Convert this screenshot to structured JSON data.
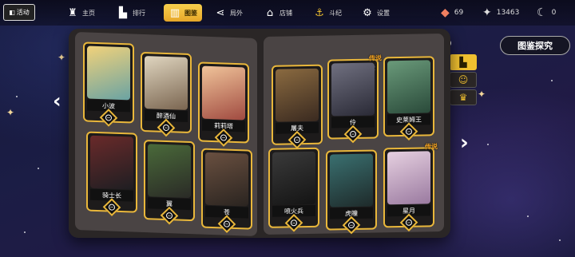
{
  "topbar": {
    "event_label": "活动",
    "nav": [
      {
        "label": "主页",
        "icon": "castle-icon"
      },
      {
        "label": "排行",
        "icon": "podium-icon"
      },
      {
        "label": "图鉴",
        "icon": "map-icon"
      },
      {
        "label": "局外",
        "icon": "share-icon"
      },
      {
        "label": "店铺",
        "icon": "shop-icon"
      },
      {
        "label": "斗纪",
        "icon": "anchor-icon"
      },
      {
        "label": "设置",
        "icon": "gear-icon"
      }
    ],
    "currencies": [
      {
        "icon": "gem-icon",
        "value": "69"
      },
      {
        "icon": "sparkle-icon",
        "value": "13463"
      },
      {
        "icon": "moon-icon",
        "value": "0"
      }
    ]
  },
  "explore_label": "图鉴探究",
  "pagination": {
    "total": 6,
    "current": 2
  },
  "side_tabs": [
    {
      "icon": "podium-icon",
      "active": true
    },
    {
      "icon": "face-icon",
      "active": false
    },
    {
      "icon": "crown-icon",
      "active": false
    }
  ],
  "legend_tag": "传说",
  "cards": [
    {
      "name": "小波"
    },
    {
      "name": "醉酒仙"
    },
    {
      "name": "莉莉塔"
    },
    {
      "name": "骑士长"
    },
    {
      "name": "翼"
    },
    {
      "name": "苍"
    },
    {
      "name": "屠夫"
    },
    {
      "name": "伶",
      "count": "52"
    },
    {
      "name": "史莱姆王"
    },
    {
      "name": "喷火兵"
    },
    {
      "name": "虎瞳"
    },
    {
      "name": "星月"
    }
  ]
}
